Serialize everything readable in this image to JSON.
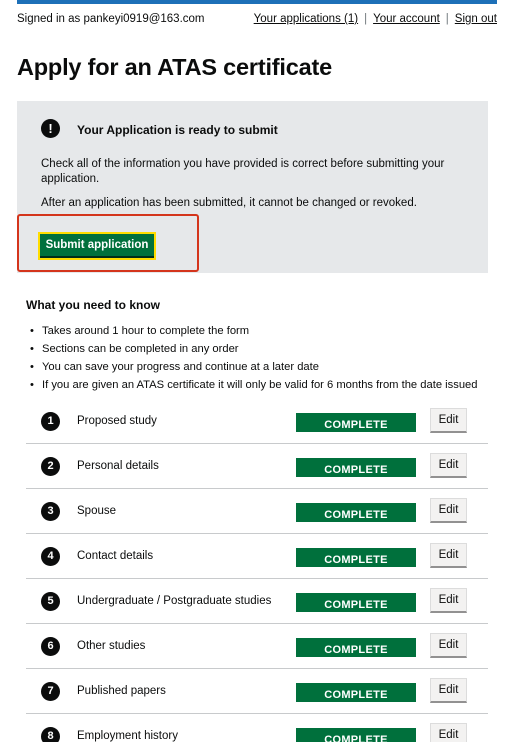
{
  "header": {
    "signed_in": "Signed in as pankeyi0919@163.com",
    "links": [
      "Your applications (1)",
      "Your account",
      "Sign out"
    ],
    "separator": "|"
  },
  "page_title": "Apply for an ATAS certificate",
  "notice": {
    "icon": "!",
    "title": "Your Application is ready to submit",
    "paragraph1": "Check all of the information you have provided is correct before submitting your application.",
    "paragraph2": "After an application has been submitted, it cannot be changed or revoked.",
    "submit_label": "Submit application"
  },
  "what_you_need": {
    "title": "What you need to know",
    "items": [
      "Takes around 1 hour to complete the form",
      "Sections can be completed in any order",
      "You can save your progress and continue at a later date",
      "If you are given an ATAS certificate it will only be valid for 6 months from the date issued"
    ]
  },
  "tasks": [
    {
      "number": "1",
      "label": "Proposed study",
      "status": "COMPLETE",
      "action": "Edit"
    },
    {
      "number": "2",
      "label": "Personal details",
      "status": "COMPLETE",
      "action": "Edit"
    },
    {
      "number": "3",
      "label": "Spouse",
      "status": "COMPLETE",
      "action": "Edit"
    },
    {
      "number": "4",
      "label": "Contact details",
      "status": "COMPLETE",
      "action": "Edit"
    },
    {
      "number": "5",
      "label": "Undergraduate / Postgraduate studies",
      "status": "COMPLETE",
      "action": "Edit"
    },
    {
      "number": "6",
      "label": "Other studies",
      "status": "COMPLETE",
      "action": "Edit"
    },
    {
      "number": "7",
      "label": "Published papers",
      "status": "COMPLETE",
      "action": "Edit"
    },
    {
      "number": "8",
      "label": "Employment history",
      "status": "COMPLETE",
      "action": "Edit"
    }
  ],
  "colors": {
    "brand_bar": "#1d70b8",
    "complete_tag": "#00703c",
    "button_green": "#00703c",
    "highlight_border": "#d4351c",
    "panel_bg": "#e6e8ea"
  }
}
